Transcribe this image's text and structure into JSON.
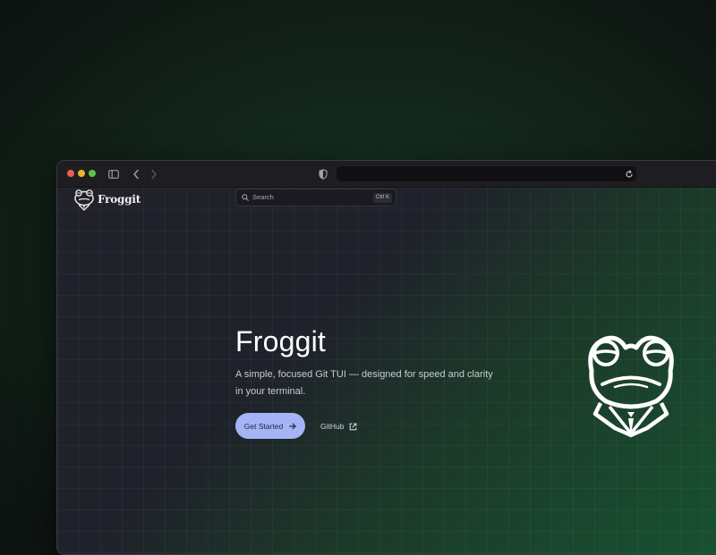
{
  "browser": {
    "url": "",
    "window_controls": [
      "close",
      "minimize",
      "maximize"
    ],
    "toolbar_icons": [
      "sidebar-icon",
      "back-icon",
      "forward-icon",
      "privacy-shield-icon",
      "reload-icon"
    ]
  },
  "site": {
    "brand": "Froggit",
    "search": {
      "placeholder": "Search",
      "shortcut": "Ctrl K"
    },
    "hero": {
      "title": "Froggit",
      "description": "A simple, focused Git TUI — designed for speed and clarity in your terminal.",
      "primary_button": "Get Started",
      "secondary_link": "GitHub"
    }
  },
  "colors": {
    "primary_button": "#a4b4f6",
    "accent_green": "#175232",
    "page_dark": "#21212a"
  }
}
